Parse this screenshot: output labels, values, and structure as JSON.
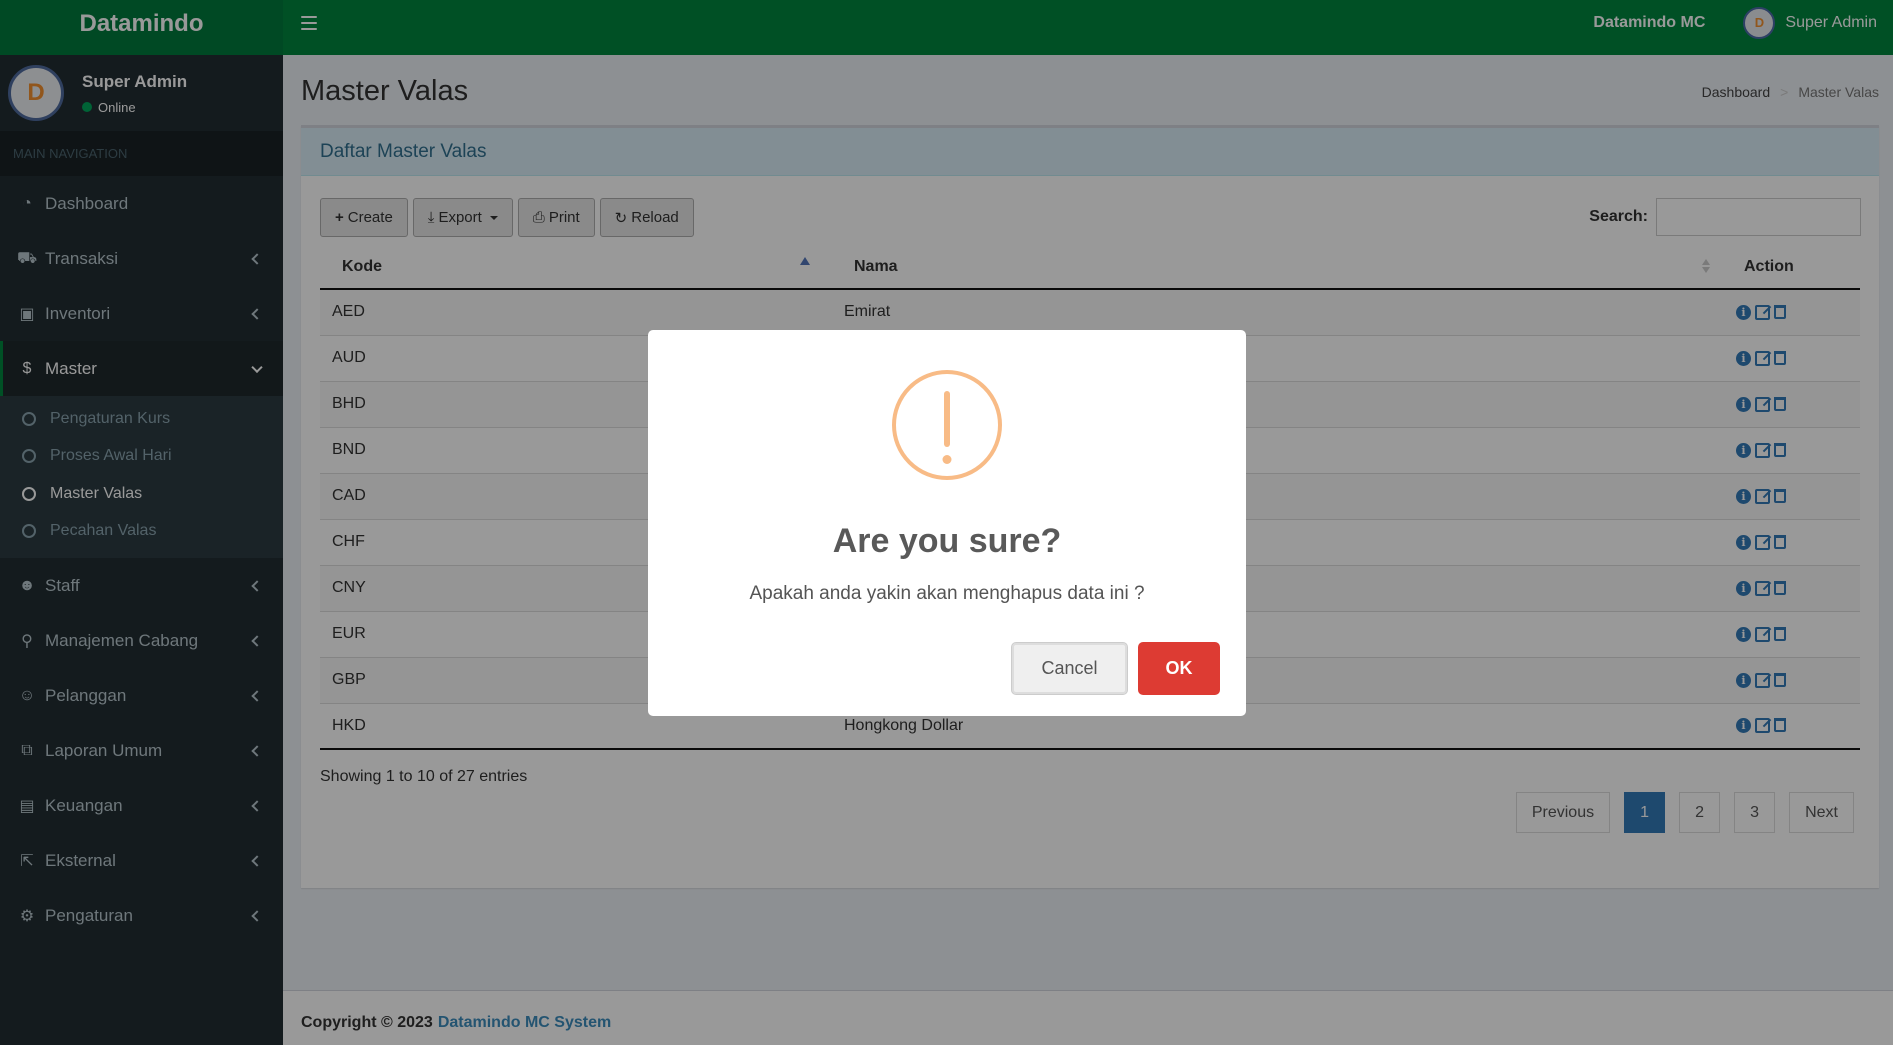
{
  "header": {
    "brand": "Datamindo",
    "app_name": "Datamindo MC",
    "user": "Super Admin",
    "avatar_text": "D"
  },
  "sidebar": {
    "user_name": "Super Admin",
    "status": "Online",
    "nav_header": "MAIN NAVIGATION",
    "items": [
      {
        "label": "Dashboard",
        "icon": "dashboard-icon"
      },
      {
        "label": "Transaksi",
        "icon": "cart-icon"
      },
      {
        "label": "Inventori",
        "icon": "money-icon"
      },
      {
        "label": "Master",
        "icon": "dollar-icon"
      },
      {
        "label": "Staff",
        "icon": "user-plus-icon"
      },
      {
        "label": "Manajemen Cabang",
        "icon": "map-marker-icon"
      },
      {
        "label": "Pelanggan",
        "icon": "users-icon"
      },
      {
        "label": "Laporan Umum",
        "icon": "copy-icon"
      },
      {
        "label": "Keuangan",
        "icon": "book-icon"
      },
      {
        "label": "Eksternal",
        "icon": "external-link-icon"
      },
      {
        "label": "Pengaturan",
        "icon": "gear-icon"
      }
    ],
    "submenu": [
      {
        "label": "Pengaturan Kurs"
      },
      {
        "label": "Proses Awal Hari"
      },
      {
        "label": "Master Valas"
      },
      {
        "label": "Pecahan Valas"
      }
    ]
  },
  "page": {
    "title": "Master Valas",
    "breadcrumb": {
      "home": "Dashboard",
      "sep": ">",
      "current": "Master Valas"
    },
    "box_title": "Daftar Master Valas"
  },
  "toolbar": {
    "create": "Create",
    "export": "Export",
    "print": "Print",
    "reload": "Reload",
    "search_label": "Search:",
    "search_value": ""
  },
  "table": {
    "headers": {
      "kode": "Kode",
      "nama": "Nama",
      "action": "Action"
    },
    "rows": [
      {
        "kode": "AED",
        "nama": "Emirat"
      },
      {
        "kode": "AUD",
        "nama": ""
      },
      {
        "kode": "BHD",
        "nama": ""
      },
      {
        "kode": "BND",
        "nama": ""
      },
      {
        "kode": "CAD",
        "nama": ""
      },
      {
        "kode": "CHF",
        "nama": ""
      },
      {
        "kode": "CNY",
        "nama": ""
      },
      {
        "kode": "EUR",
        "nama": ""
      },
      {
        "kode": "GBP",
        "nama": ""
      },
      {
        "kode": "HKD",
        "nama": "Hongkong Dollar"
      }
    ],
    "info": "Showing 1 to 10 of 27 entries"
  },
  "pagination": {
    "previous": "Previous",
    "pages": [
      "1",
      "2",
      "3"
    ],
    "next": "Next",
    "current": 1
  },
  "footer": {
    "text": "Copyright © 2023",
    "link": "Datamindo MC System"
  },
  "dialog": {
    "title": "Are you sure?",
    "text": "Apakah anda yakin akan menghapus data ini ?",
    "cancel": "Cancel",
    "ok": "OK",
    "icon": "warning-icon"
  }
}
